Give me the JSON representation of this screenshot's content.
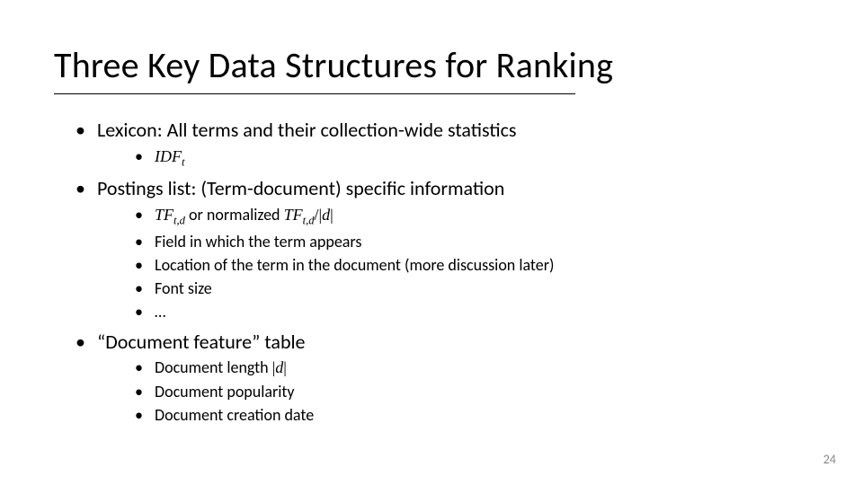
{
  "title": "Three Key Data Structures for Ranking",
  "bullets": {
    "lexicon": {
      "label_prefix": "Lexicon: ",
      "label_rest": "All terms and their collection-wide statistics",
      "sub": {
        "idf_base": "IDF",
        "idf_sub": "t"
      }
    },
    "postings": {
      "label_prefix": "Postings list: ",
      "label_rest": "(Term-document) specific information",
      "sub": {
        "tf_base1": "TF",
        "tf_sub1": "t,d",
        "or_norm": " or normalized ",
        "tf_base2": "TF",
        "tf_sub2": "t,d",
        "slash": "/",
        "bar_d": "|d|",
        "field": "Field in which the term appears",
        "location": "Location of the term in the document (more discussion later)",
        "font_size": "Font size",
        "ellipsis": "…"
      }
    },
    "docfeat": {
      "label": "“Document feature” table",
      "sub": {
        "dl_prefix": "Document length ",
        "dl_bar_d": "|d|",
        "pop": "Document popularity",
        "date": "Document creation date"
      }
    }
  },
  "page_number": "24"
}
